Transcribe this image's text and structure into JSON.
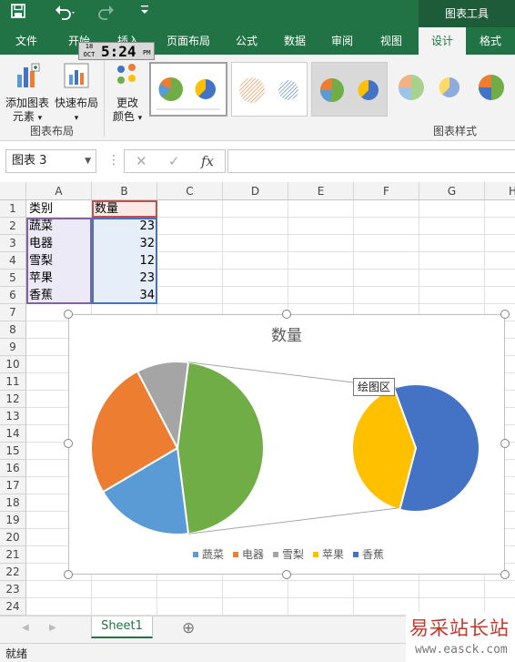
{
  "quick_access": {
    "save_icon": "save-icon",
    "undo_icon": "undo-icon",
    "redo_icon": "redo-icon",
    "customize_icon": "customize-icon"
  },
  "title_bar": {
    "contextual_tools": "图表工具"
  },
  "tabs": [
    {
      "label": "文件",
      "active": false
    },
    {
      "label": "开始",
      "active": false
    },
    {
      "label": "插入",
      "active": false
    },
    {
      "label": "页面布局",
      "active": false
    },
    {
      "label": "公式",
      "active": false
    },
    {
      "label": "数据",
      "active": false
    },
    {
      "label": "审阅",
      "active": false
    },
    {
      "label": "视图",
      "active": false
    },
    {
      "label": "设计",
      "active": true
    },
    {
      "label": "格式",
      "active": false
    }
  ],
  "clock": {
    "day": "18",
    "month": "OCT",
    "time": "5:24",
    "ampm": "PM"
  },
  "ribbon": {
    "add_element": {
      "line1": "添加图表",
      "line2": "元素",
      "arrow": "▾"
    },
    "quick_layout": {
      "line1": "快速布局",
      "arrow": "▾"
    },
    "change_color": {
      "line1": "更改",
      "line2": "颜色",
      "arrow": "▾"
    },
    "group_layout": "图表布局",
    "group_styles": "图表样式"
  },
  "formula_bar": {
    "name_box": "图表 3",
    "cancel": "✕",
    "enter": "✓",
    "fx": "fx",
    "formula": ""
  },
  "columns": [
    "A",
    "B",
    "C",
    "D",
    "E",
    "F",
    "G",
    "H"
  ],
  "rows": [
    "1",
    "2",
    "3",
    "4",
    "5",
    "6",
    "7",
    "8",
    "9",
    "10",
    "11",
    "12",
    "13",
    "14",
    "15",
    "16",
    "17",
    "18",
    "19",
    "20",
    "21",
    "22",
    "23",
    "24"
  ],
  "table": {
    "header": [
      "类别",
      "数量"
    ],
    "rows": [
      [
        "蔬菜",
        "23"
      ],
      [
        "电器",
        "32"
      ],
      [
        "雪梨",
        "12"
      ],
      [
        "苹果",
        "23"
      ],
      [
        "香蕉",
        "34"
      ]
    ]
  },
  "chart_data": {
    "type": "pie",
    "subtype": "pie-of-pie",
    "title": "数量",
    "categories": [
      "蔬菜",
      "电器",
      "雪梨",
      "苹果",
      "香蕉"
    ],
    "values": [
      23,
      32,
      12,
      23,
      34
    ],
    "colors": [
      "#5b9bd5",
      "#ed7d31",
      "#a5a5a5",
      "#ffc000",
      "#4472c4"
    ],
    "secondary_plot": [
      "苹果",
      "香蕉"
    ],
    "other_slice_color": "#70ad47",
    "legend_position": "bottom",
    "tooltip": "绘图区"
  },
  "sheets": [
    {
      "name": "Sheet1",
      "active": true
    }
  ],
  "add_sheet": "⊕",
  "status": "就绪",
  "watermark": {
    "line1": "易采站长站",
    "line2": "www.easck.com"
  }
}
